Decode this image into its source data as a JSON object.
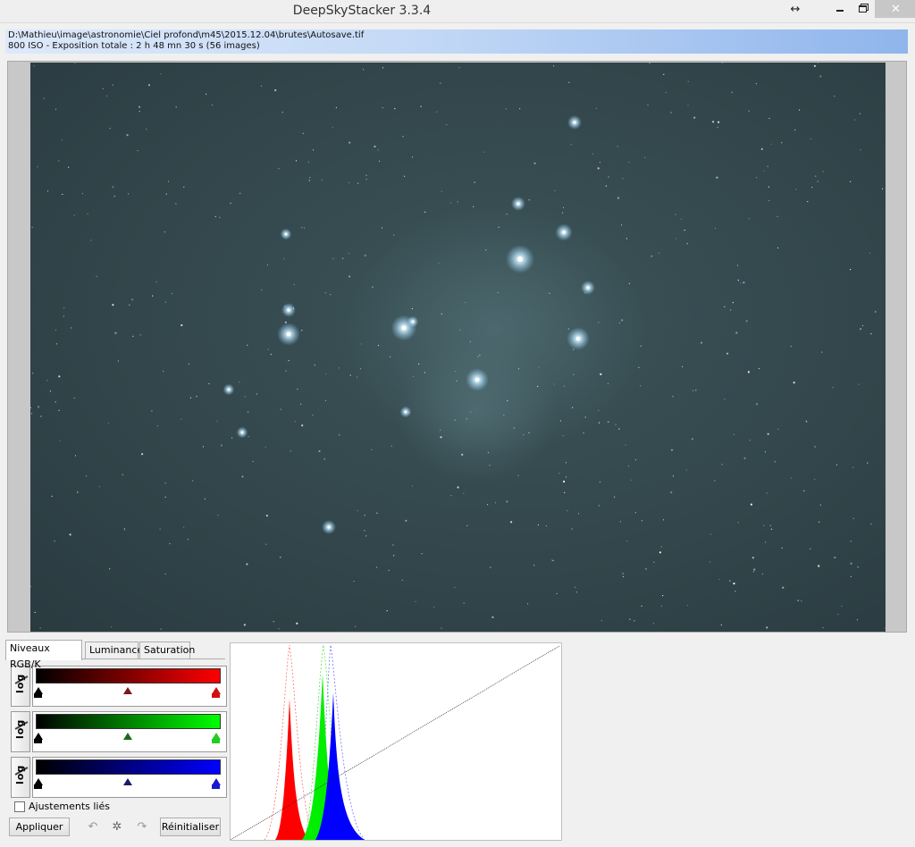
{
  "window": {
    "title": "DeepSkyStacker 3.3.4",
    "resize_icon": "↔",
    "close_icon": "✕"
  },
  "info": {
    "path": "D:\\Mathieu\\image\\astronomie\\Ciel profond\\m45\\2015.12.04\\brutes\\Autosave.tif",
    "details": "800 ISO - Exposition totale : 2 h 48 mn 30 s (56 images)"
  },
  "tabs": [
    {
      "label": "Niveaux RGB/K",
      "active": true
    },
    {
      "label": "Luminance",
      "active": false
    },
    {
      "label": "Saturation",
      "active": false
    }
  ],
  "channels": {
    "log_label": "log",
    "red": {
      "color": "#ff0000",
      "black_point": 0,
      "mid_point": 0.5,
      "white_point": 1
    },
    "green": {
      "color": "#00ff00",
      "black_point": 0,
      "mid_point": 0.5,
      "white_point": 1
    },
    "blue": {
      "color": "#0000ff",
      "black_point": 0,
      "mid_point": 0.5,
      "white_point": 1
    }
  },
  "linked_adjustments": {
    "label": "Ajustements liés",
    "checked": false
  },
  "buttons": {
    "apply": "Appliquer",
    "reset": "Réinitialiser",
    "undo_icon": "↶",
    "settings_icon": "✲",
    "redo_icon": "↷"
  },
  "colors": {
    "sky": "#33474c",
    "titlebar": "#efefef",
    "infobar_accent": "#8fb5ec"
  }
}
